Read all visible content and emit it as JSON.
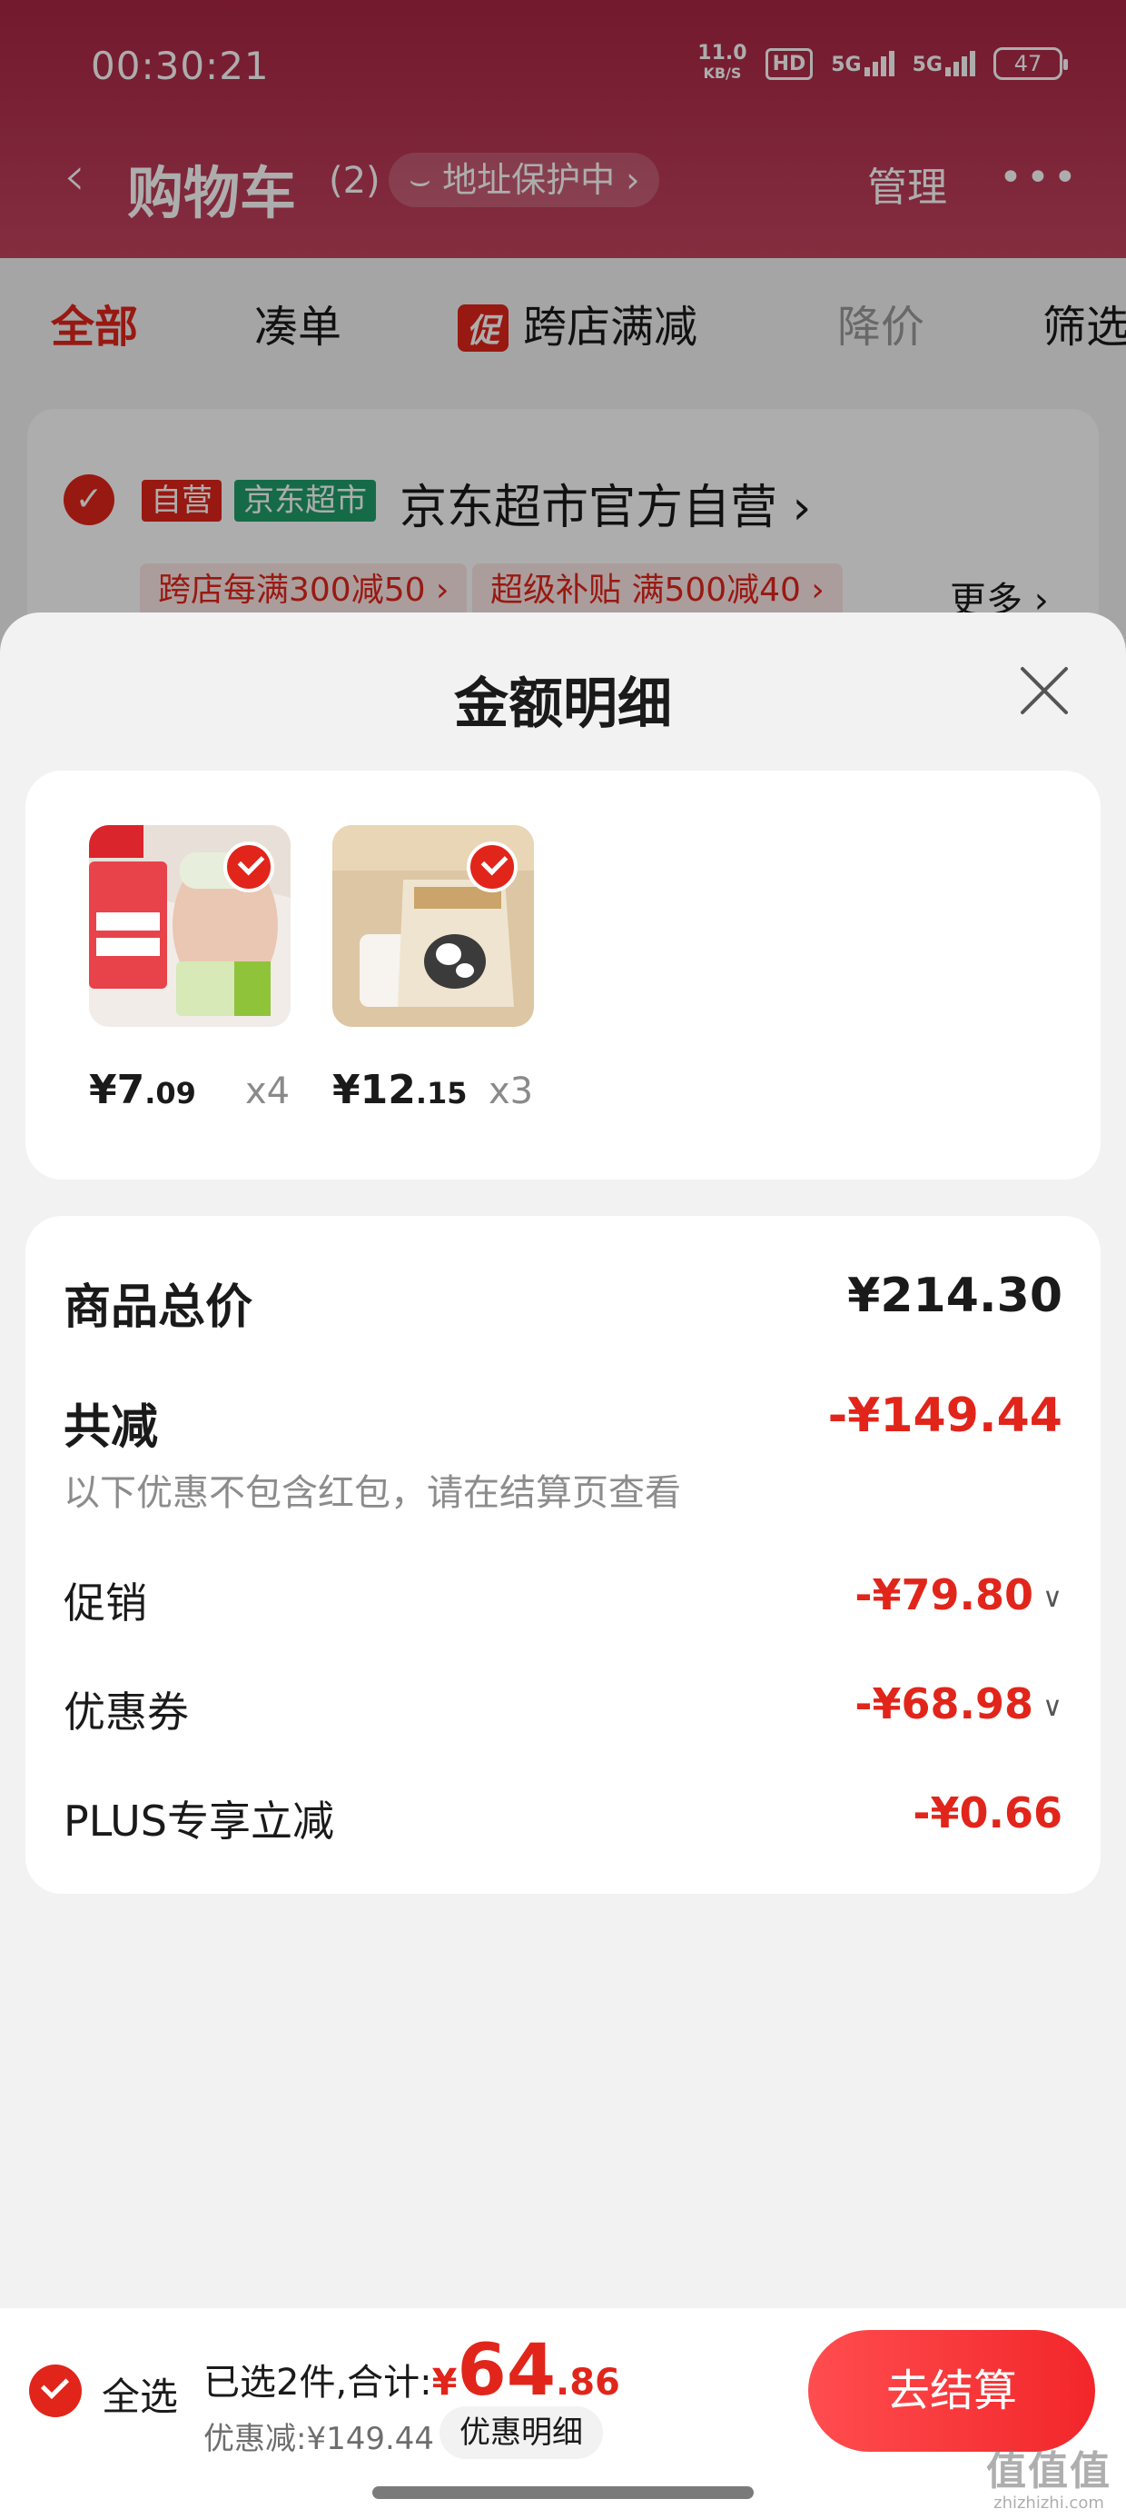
{
  "status_bar": {
    "time": "00:30:21",
    "net_speed": "11.0",
    "net_unit": "KB/S",
    "hd_badge": "HD",
    "sig1": "5G",
    "sig2": "5G",
    "battery": "47"
  },
  "nav": {
    "title": "购物车",
    "count": "(2)",
    "address_pill": "地址保护中",
    "manage": "管理"
  },
  "filter_tabs": {
    "all": "全部",
    "bundle": "凑单",
    "promo_badge": "促",
    "cross_store": "跨店满减",
    "price_drop": "降价",
    "filter": "筛选"
  },
  "store": {
    "tag_self": "自营",
    "tag_jd": "京东超市",
    "name": "京东超市官方自营",
    "promos": [
      "跨店每满300减50",
      "超级补贴 满500减40"
    ],
    "more": "更多"
  },
  "sheet": {
    "title": "金额明细",
    "items": [
      {
        "price_int": "¥7",
        "price_dec": ".09",
        "qty": "x4"
      },
      {
        "price_int": "¥12",
        "price_dec": ".15",
        "qty": "x3"
      }
    ],
    "summary": {
      "total_label": "商品总价",
      "total_value": "¥214.30",
      "reduce_label": "共减",
      "reduce_value": "-¥149.44",
      "reduce_note": "以下优惠不包含红包，请在结算页查看",
      "promo_label": "促销",
      "promo_value": "-¥79.80",
      "coupon_label": "优惠券",
      "coupon_value": "-¥68.98",
      "plus_label": "PLUS专享立减",
      "plus_value": "-¥0.66"
    }
  },
  "bottom": {
    "select_all": "全选",
    "selected_text": "已选2件,合计:",
    "yen": "¥",
    "total_int": "64",
    "total_dec": ".86",
    "discount_text": "优惠减:¥149.44",
    "discount_button": "优惠明细",
    "checkout": "去结算"
  },
  "watermark": {
    "big": "值值值",
    "small": "zhizhizhi.com"
  },
  "colors": {
    "brand_red": "#e1251b",
    "header": "#b73553"
  }
}
